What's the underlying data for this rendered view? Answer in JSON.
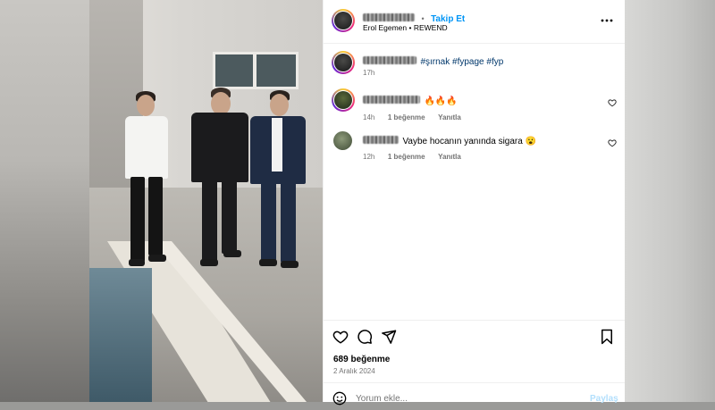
{
  "post": {
    "follow_label": "Takip Et",
    "separator": "•",
    "location_line": "Erol Egemen • REWEND",
    "caption": {
      "hashtags": "#şırnak #fypage #fyp",
      "time": "17h"
    },
    "likes": "689 beğenme",
    "date": "2 Aralık 2024",
    "comment_placeholder": "Yorum ekle...",
    "share_label": "Paylaş"
  },
  "comments": [
    {
      "text": "🔥🔥🔥",
      "time": "14h",
      "likes": "1 beğenme",
      "reply": "Yanıtla"
    },
    {
      "text": "Vaybe hocanın yanında sigara 😮",
      "time": "12h",
      "likes": "1 beğenme",
      "reply": "Yanıtla"
    }
  ],
  "icons": {
    "more": "more-options-icon",
    "like": "heart-icon",
    "comment": "comment-icon",
    "share": "paper-plane-icon",
    "save": "bookmark-icon",
    "emoji": "emoji-icon",
    "mute": "speaker-icon"
  },
  "colors": {
    "accent": "#0095f6",
    "hashtag": "#00376b",
    "muted": "#737373"
  }
}
